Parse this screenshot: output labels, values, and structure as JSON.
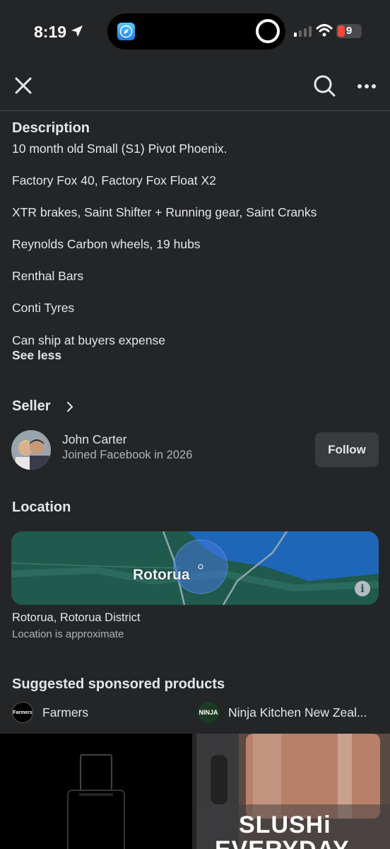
{
  "status": {
    "time": "8:19",
    "battery": "9"
  },
  "description": {
    "title": "Description",
    "lines": [
      "10 month old Small (S1) Pivot Phoenix.",
      "Factory Fox 40, Factory Fox Float X2",
      "XTR brakes, Saint Shifter + Running gear, Saint Cranks",
      "Reynolds Carbon wheels, 19 hubs",
      "Renthal Bars",
      "Conti Tyres",
      "Can ship at buyers expense"
    ],
    "see_less": "See less"
  },
  "seller": {
    "title": "Seller",
    "name": "John Carter",
    "joined": "Joined Facebook in 2026",
    "follow_label": "Follow"
  },
  "location": {
    "title": "Location",
    "map_label": "Rotorua",
    "name": "Rotorua, Rotorua District",
    "note": "Location is approximate"
  },
  "sponsored": {
    "title": "Suggested sponsored products",
    "brands": [
      {
        "name": "Farmers",
        "logo_text": "Farmers"
      },
      {
        "name": "Ninja Kitchen New Zeal...",
        "logo_text": "NINJA"
      }
    ],
    "product_text_1": "SLUSHi",
    "product_text_2": "EVERYDAY"
  },
  "colors": {
    "background": "#242526",
    "map_water": "#1e66b8",
    "map_land": "#1f5a4c"
  }
}
